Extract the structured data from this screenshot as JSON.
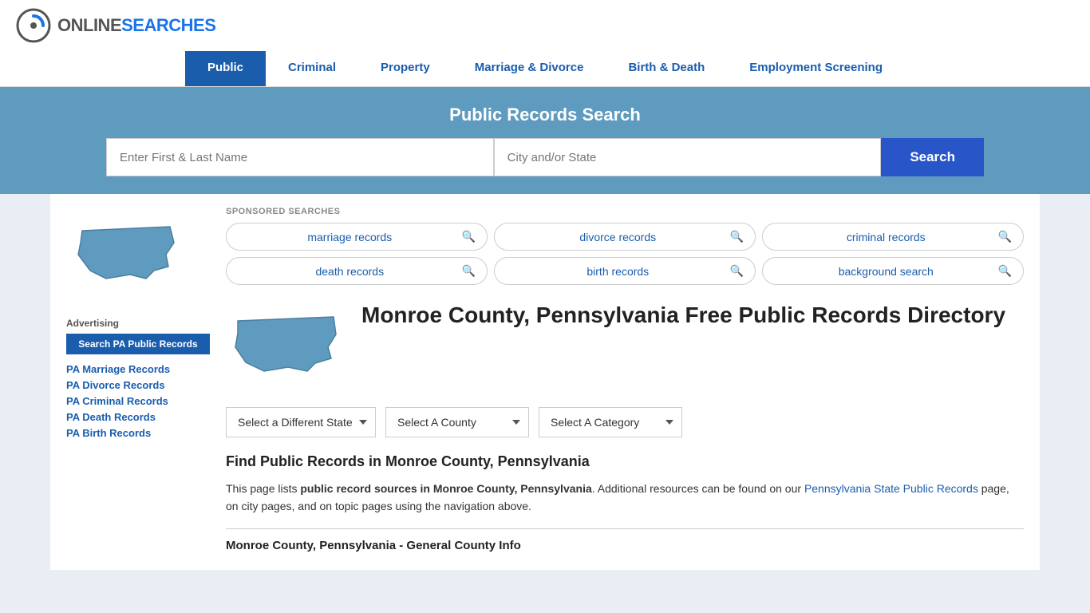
{
  "header": {
    "logo_online": "ONLINE",
    "logo_searches": "SEARCHES"
  },
  "nav": {
    "items": [
      {
        "label": "Public",
        "active": true
      },
      {
        "label": "Criminal",
        "active": false
      },
      {
        "label": "Property",
        "active": false
      },
      {
        "label": "Marriage & Divorce",
        "active": false
      },
      {
        "label": "Birth & Death",
        "active": false
      },
      {
        "label": "Employment Screening",
        "active": false
      }
    ]
  },
  "search_banner": {
    "title": "Public Records Search",
    "name_placeholder": "Enter First & Last Name",
    "location_placeholder": "City and/or State",
    "search_button_label": "Search"
  },
  "sponsored": {
    "label": "SPONSORED SEARCHES",
    "items": [
      {
        "text": "marriage records"
      },
      {
        "text": "divorce records"
      },
      {
        "text": "criminal records"
      },
      {
        "text": "death records"
      },
      {
        "text": "birth records"
      },
      {
        "text": "background search"
      }
    ]
  },
  "page": {
    "title": "Monroe County, Pennsylvania Free Public Records Directory",
    "dropdown_state": "Select a Different State",
    "dropdown_county": "Select A County",
    "dropdown_category": "Select A Category",
    "find_title": "Find Public Records in Monroe County, Pennsylvania",
    "find_text_1": "This page lists ",
    "find_text_bold": "public record sources in Monroe County, Pennsylvania",
    "find_text_2": ". Additional resources can be found on our ",
    "find_link": "Pennsylvania State Public Records",
    "find_text_3": " page, on city pages, and on topic pages using the navigation above.",
    "county_info_title": "Monroe County, Pennsylvania - General County Info"
  },
  "sidebar": {
    "advertising_label": "Advertising",
    "ad_button_label": "Search PA Public Records",
    "links": [
      {
        "label": "PA Marriage Records"
      },
      {
        "label": "PA Divorce Records"
      },
      {
        "label": "PA Criminal Records"
      },
      {
        "label": "PA Death Records"
      },
      {
        "label": "PA Birth Records"
      }
    ]
  }
}
